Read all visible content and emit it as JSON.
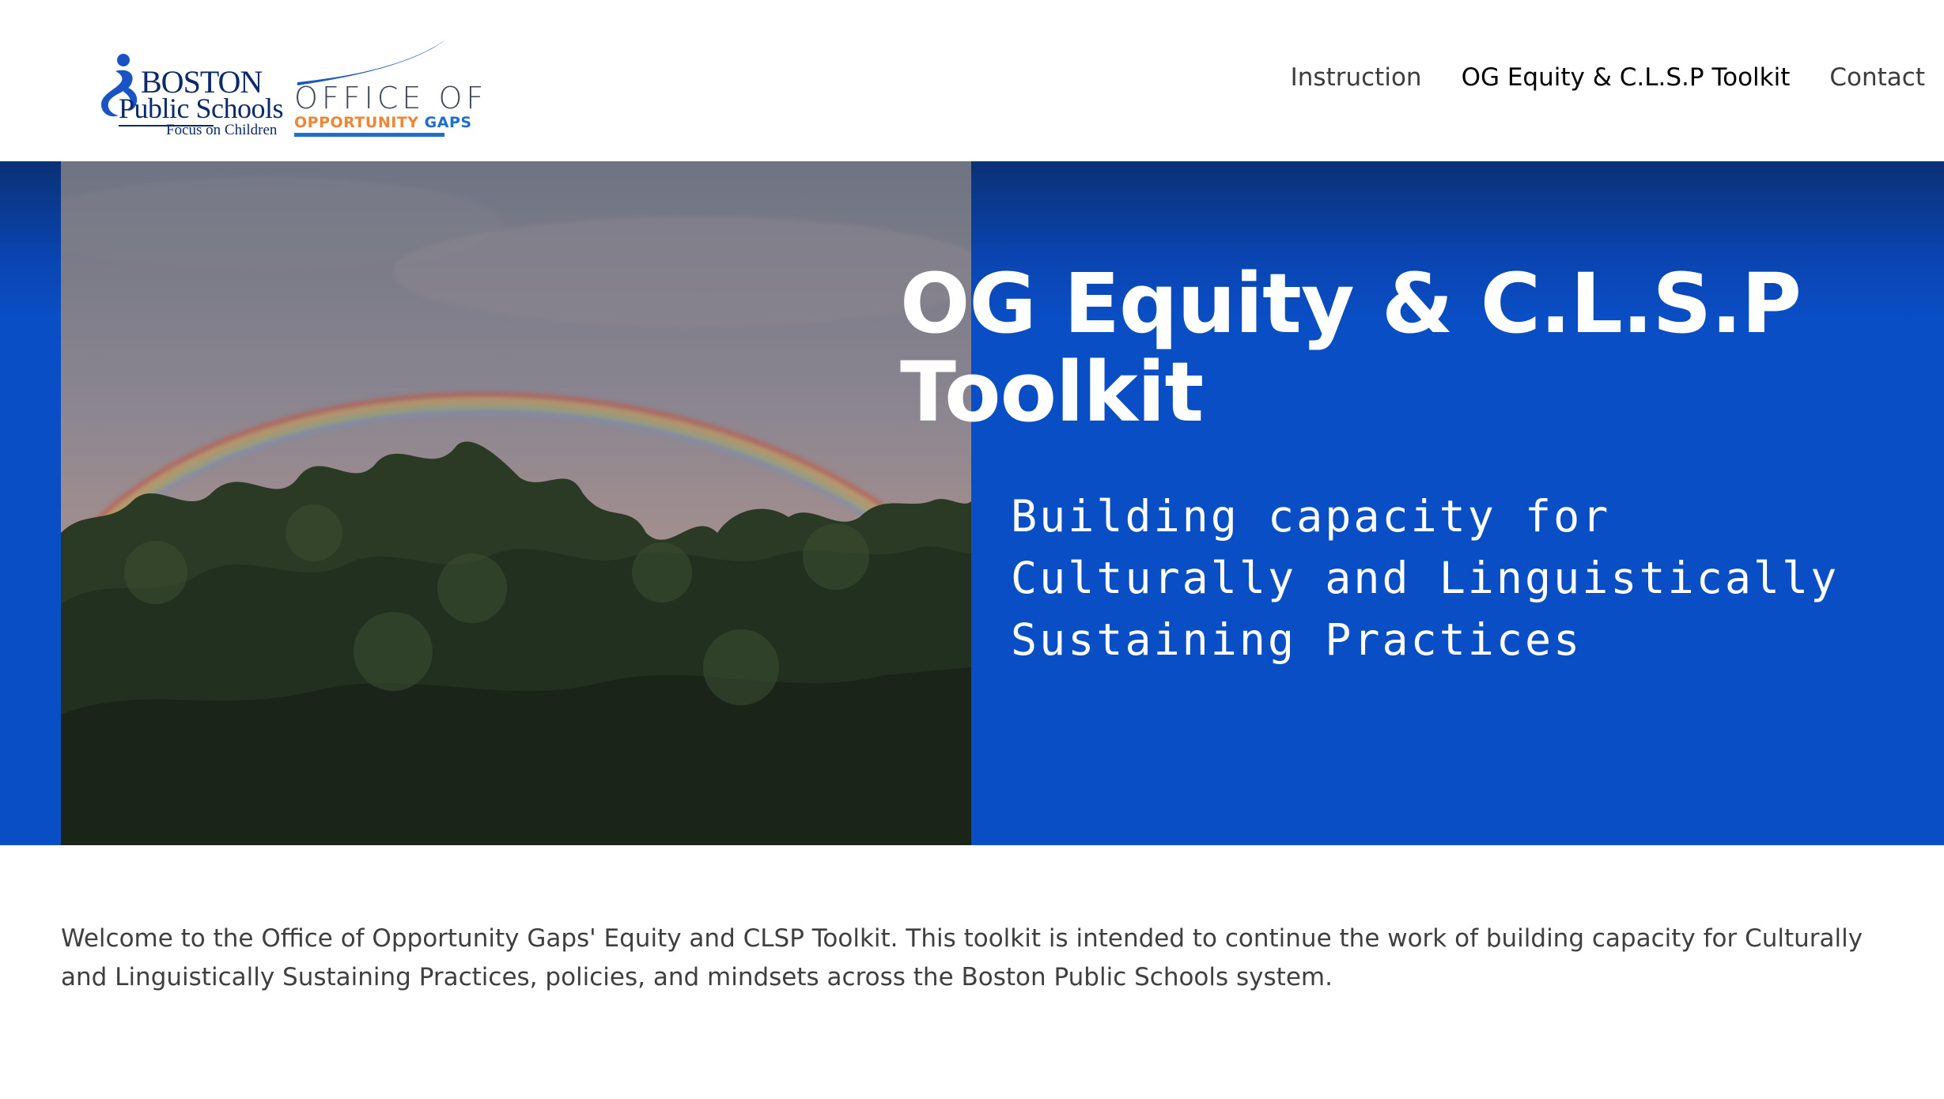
{
  "header": {
    "logo_bps": {
      "line1": "BOSTON",
      "line2": "Public Schools",
      "line3": "Focus on Children"
    },
    "logo_og": {
      "line1": "OFFICE OF",
      "line2_opportunity": "OPPORTUNITY",
      "line2_gaps": "GAPS"
    },
    "nav": [
      {
        "label": "Instruction",
        "active": false
      },
      {
        "label": "OG Equity & C.L.S.P Toolkit",
        "active": true
      },
      {
        "label": "Contact",
        "active": false
      }
    ]
  },
  "hero": {
    "title": "OG Equity & C.L.S.P Toolkit",
    "subtitle": "Building capacity for\nCulturally and Linguistically\nSustaining Practices",
    "image_subject": "rainbow-over-trees"
  },
  "intro": {
    "text": "Welcome to the Office of Opportunity Gaps' Equity and CLSP Toolkit. This toolkit is intended to continue the work of building capacity for Culturally and Linguistically Sustaining Practices, policies, and mindsets across the Boston Public Schools system."
  },
  "colors": {
    "hero_blue": "#0a4ec5",
    "hero_top": "#0b3175",
    "logo_navy": "#0b2a6b",
    "logo_orange": "#ee8633",
    "logo_blue": "#1f6fd1",
    "body_text": "#3f3f3f"
  }
}
